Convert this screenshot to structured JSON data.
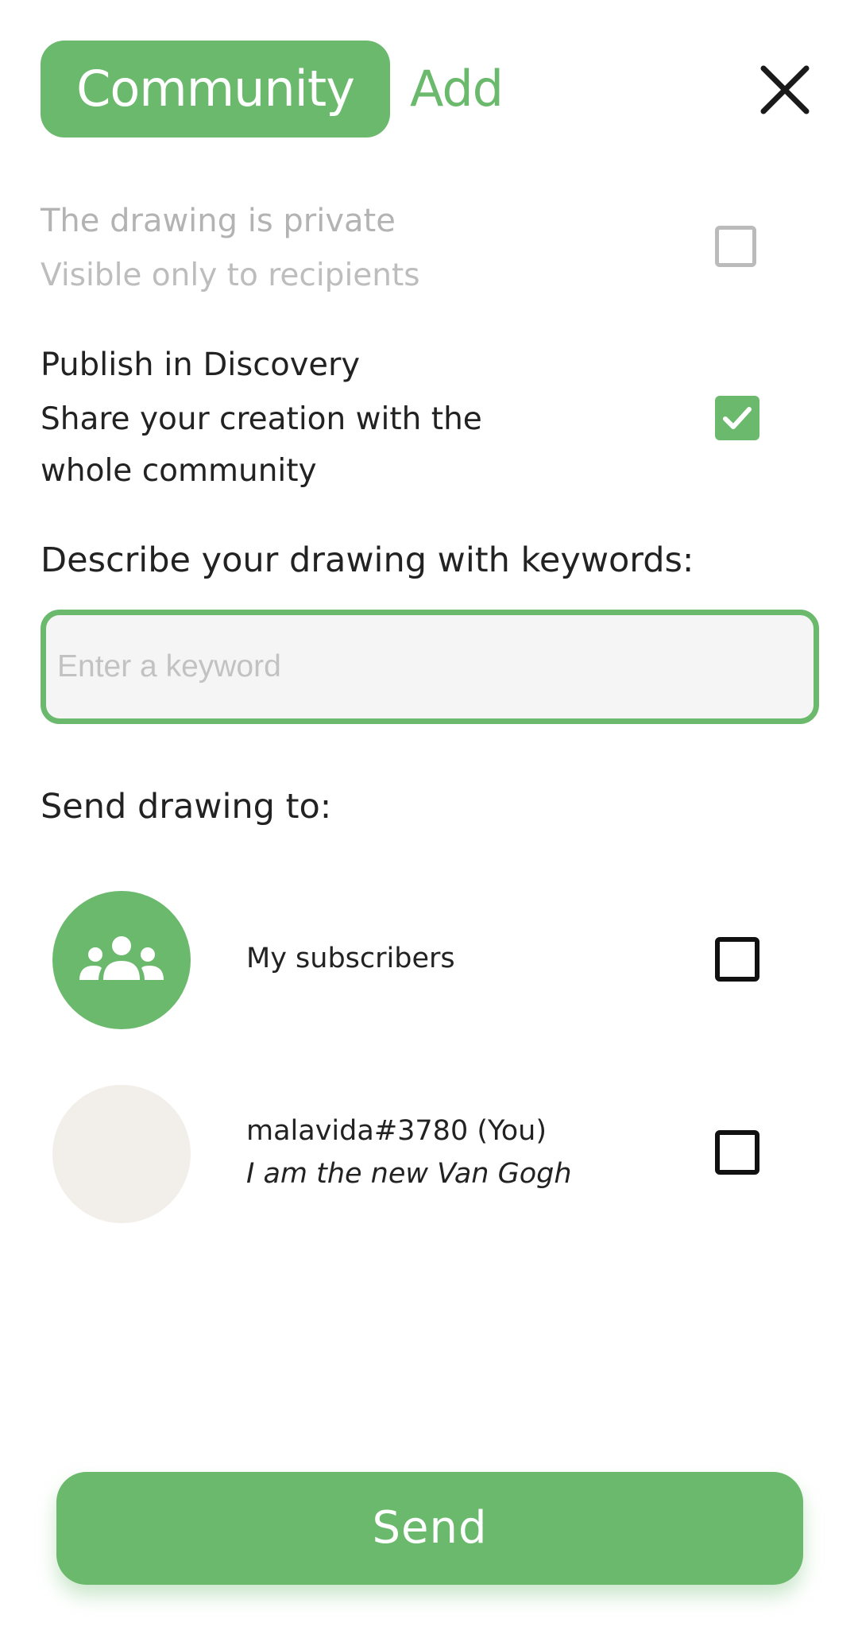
{
  "header": {
    "tab_community": "Community",
    "tab_add": "Add",
    "close_icon": "close-icon",
    "accent_color": "#6ab96c"
  },
  "options": {
    "private": {
      "title": "The drawing is private",
      "subtitle": "Visible only to recipients",
      "checked": false,
      "enabled": false
    },
    "publish": {
      "title": "Publish in Discovery",
      "subtitle": "Share your creation with the whole community",
      "checked": true
    }
  },
  "keywords": {
    "label": "Describe your drawing with keywords:",
    "placeholder": "Enter a keyword",
    "value": ""
  },
  "send_to": {
    "label": "Send drawing to:",
    "recipients": [
      {
        "name": "My subscribers",
        "icon": "group-icon",
        "checked": false
      },
      {
        "name": "malavida#3780 (You)",
        "status": "I am the new Van Gogh",
        "checked": false
      }
    ]
  },
  "send_button": {
    "label": "Send"
  }
}
